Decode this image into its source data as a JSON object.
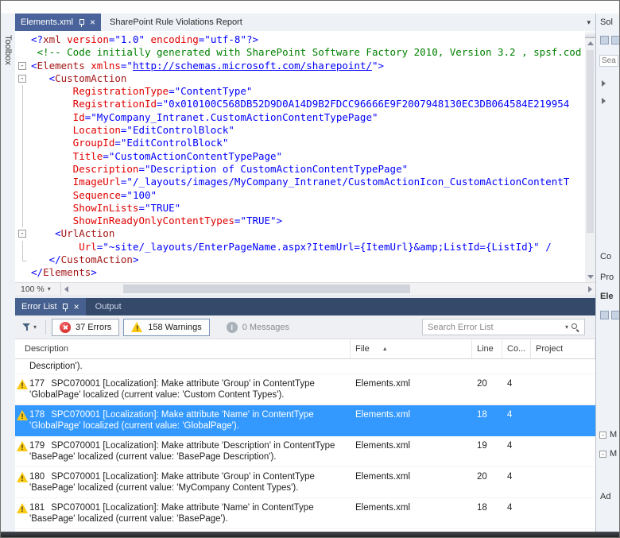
{
  "toolbox_label": "Toolbox",
  "doc_tabs": {
    "active_label": "Elements.xml",
    "inactive_label": "SharePoint Rule Violations Report"
  },
  "editor": {
    "zoom_label": "100 %",
    "lines": [
      {
        "ind": 0,
        "m": "",
        "tokens": [
          [
            "d",
            "<?"
          ],
          [
            "e",
            "xml"
          ],
          [
            "a",
            " version"
          ],
          [
            "d",
            "="
          ],
          [
            "v",
            "\"1.0\""
          ],
          [
            "a",
            " encoding"
          ],
          [
            "d",
            "="
          ],
          [
            "v",
            "\"utf-8\""
          ],
          [
            "d",
            "?>"
          ]
        ]
      },
      {
        "ind": 1,
        "m": "",
        "tokens": [
          [
            "c",
            "<!-- Code initially generated with SharePoint Software Factory 2010, Version 3.2 , spsf.cod"
          ]
        ]
      },
      {
        "ind": 0,
        "m": "box",
        "tokens": [
          [
            "d",
            "<"
          ],
          [
            "e",
            "Elements"
          ],
          [
            "a",
            " xmlns"
          ],
          [
            "d",
            "=\""
          ],
          [
            "u",
            "http://schemas.microsoft.com/sharepoint/"
          ],
          [
            "d",
            "\">"
          ]
        ]
      },
      {
        "ind": 3,
        "m": "box",
        "tokens": [
          [
            "d",
            "<"
          ],
          [
            "e",
            "CustomAction"
          ]
        ]
      },
      {
        "ind": 7,
        "m": "line",
        "tokens": [
          [
            "a",
            "RegistrationType"
          ],
          [
            "d",
            "="
          ],
          [
            "v",
            "\"ContentType\""
          ]
        ]
      },
      {
        "ind": 7,
        "m": "line",
        "tokens": [
          [
            "a",
            "RegistrationId"
          ],
          [
            "d",
            "="
          ],
          [
            "v",
            "\"0x010100C568DB52D9D0A14D9B2FDCC96666E9F2007948130EC3DB064584E219954"
          ]
        ]
      },
      {
        "ind": 7,
        "m": "line",
        "tokens": [
          [
            "a",
            "Id"
          ],
          [
            "d",
            "="
          ],
          [
            "v",
            "\"MyCompany_Intranet.CustomActionContentTypePage\""
          ]
        ]
      },
      {
        "ind": 7,
        "m": "line",
        "tokens": [
          [
            "a",
            "Location"
          ],
          [
            "d",
            "="
          ],
          [
            "v",
            "\"EditControlBlock\""
          ]
        ]
      },
      {
        "ind": 7,
        "m": "line",
        "tokens": [
          [
            "a",
            "GroupId"
          ],
          [
            "d",
            "="
          ],
          [
            "v",
            "\"EditControlBlock\""
          ]
        ]
      },
      {
        "ind": 7,
        "m": "line",
        "tokens": [
          [
            "a",
            "Title"
          ],
          [
            "d",
            "="
          ],
          [
            "v",
            "\"CustomActionContentTypePage\""
          ]
        ]
      },
      {
        "ind": 7,
        "m": "line",
        "tokens": [
          [
            "a",
            "Description"
          ],
          [
            "d",
            "="
          ],
          [
            "v",
            "\"Description of CustomActionContentTypePage\""
          ]
        ]
      },
      {
        "ind": 7,
        "m": "line",
        "tokens": [
          [
            "a",
            "ImageUrl"
          ],
          [
            "d",
            "="
          ],
          [
            "v",
            "\"/_layouts/images/MyCompany_Intranet/CustomActionIcon_CustomActionContentT"
          ]
        ]
      },
      {
        "ind": 7,
        "m": "line",
        "tokens": [
          [
            "a",
            "Sequence"
          ],
          [
            "d",
            "="
          ],
          [
            "v",
            "\"100\""
          ]
        ]
      },
      {
        "ind": 7,
        "m": "line",
        "tokens": [
          [
            "a",
            "ShowInLists"
          ],
          [
            "d",
            "="
          ],
          [
            "v",
            "\"TRUE\""
          ]
        ]
      },
      {
        "ind": 7,
        "m": "line",
        "tokens": [
          [
            "q",
            "ShowInReadyOnlyContentTypes"
          ],
          [
            "d",
            "="
          ],
          [
            "v",
            "\"TRUE\""
          ],
          [
            "d",
            ">"
          ]
        ]
      },
      {
        "ind": 4,
        "m": "box",
        "tokens": [
          [
            "d",
            "<"
          ],
          [
            "e",
            "UrlAction"
          ]
        ]
      },
      {
        "ind": 8,
        "m": "line",
        "tokens": [
          [
            "a",
            "Url"
          ],
          [
            "d",
            "="
          ],
          [
            "v",
            "\"~site/_layouts/EnterPageName.aspx?ItemUrl={ItemUrl}&amp;ListId={ListId}\""
          ],
          [
            "d",
            " /"
          ]
        ]
      },
      {
        "ind": 3,
        "m": "end",
        "tokens": [
          [
            "d",
            "</"
          ],
          [
            "e",
            "CustomAction"
          ],
          [
            "d",
            ">"
          ]
        ]
      },
      {
        "ind": 0,
        "m": "",
        "tokens": [
          [
            "d",
            "</"
          ],
          [
            "e",
            "Elements"
          ],
          [
            "d",
            ">"
          ]
        ]
      }
    ]
  },
  "error_panel": {
    "tabs": [
      {
        "label": "Error List",
        "active": true
      },
      {
        "label": "Output",
        "active": false
      }
    ],
    "filters": {
      "errors_label": "37 Errors",
      "warnings_label": "158 Warnings",
      "messages_label": "0 Messages",
      "search_placeholder": "Search Error List"
    },
    "columns": [
      "Description",
      "File",
      "Line",
      "Co...",
      "Project"
    ],
    "partial_row_text": "Description').",
    "rows": [
      {
        "num": "177",
        "description": "SPC070001 [Localization]: Make attribute 'Group' in ContentType 'GlobalPage' localized (current value: 'Custom Content Types').",
        "file": "Elements.xml",
        "line": "20",
        "column": "4",
        "project": "",
        "selected": false
      },
      {
        "num": "178",
        "description": "SPC070001 [Localization]: Make attribute 'Name' in ContentType 'GlobalPage' localized (current value: 'GlobalPage').",
        "file": "Elements.xml",
        "line": "18",
        "column": "4",
        "project": "",
        "selected": true
      },
      {
        "num": "179",
        "description": "SPC070001 [Localization]: Make attribute 'Description' in ContentType 'BasePage' localized (current value: 'BasePage Description').",
        "file": "Elements.xml",
        "line": "19",
        "column": "4",
        "project": "",
        "selected": false
      },
      {
        "num": "180",
        "description": "SPC070001 [Localization]: Make attribute 'Group' in ContentType 'BasePage' localized (current value: 'MyCompany Content Types').",
        "file": "Elements.xml",
        "line": "20",
        "column": "4",
        "project": "",
        "selected": false
      },
      {
        "num": "181",
        "description": "SPC070001 [Localization]: Make attribute 'Name' in ContentType 'BasePage' localized (current value: 'BasePage').",
        "file": "Elements.xml",
        "line": "18",
        "column": "4",
        "project": "",
        "selected": false
      }
    ]
  },
  "sidebar": {
    "solution": "Sol",
    "search": "Sea",
    "code": "Co",
    "properties": "Pro",
    "element": "Ele",
    "misc1": "M",
    "misc2": "M",
    "advanced": "Ad"
  },
  "icons": {
    "pin": "pushpin",
    "close": "x",
    "filter": "funnel",
    "error": "red-circle-x",
    "warning": "yellow-triangle-exclamation",
    "info": "gray-circle-i",
    "search": "magnifier",
    "sort_ascending": "up-triangle",
    "dropdown": "down-chevron"
  },
  "colors": {
    "active_doc_tab": "#4A649B",
    "tool_tabstrip": "#35496B",
    "selected_row": "#3399FF",
    "xml_delimiter": "#0000FF",
    "xml_element": "#A31515",
    "xml_attribute": "#E00000",
    "xml_value": "#0000FF",
    "xml_comment": "#008000"
  }
}
